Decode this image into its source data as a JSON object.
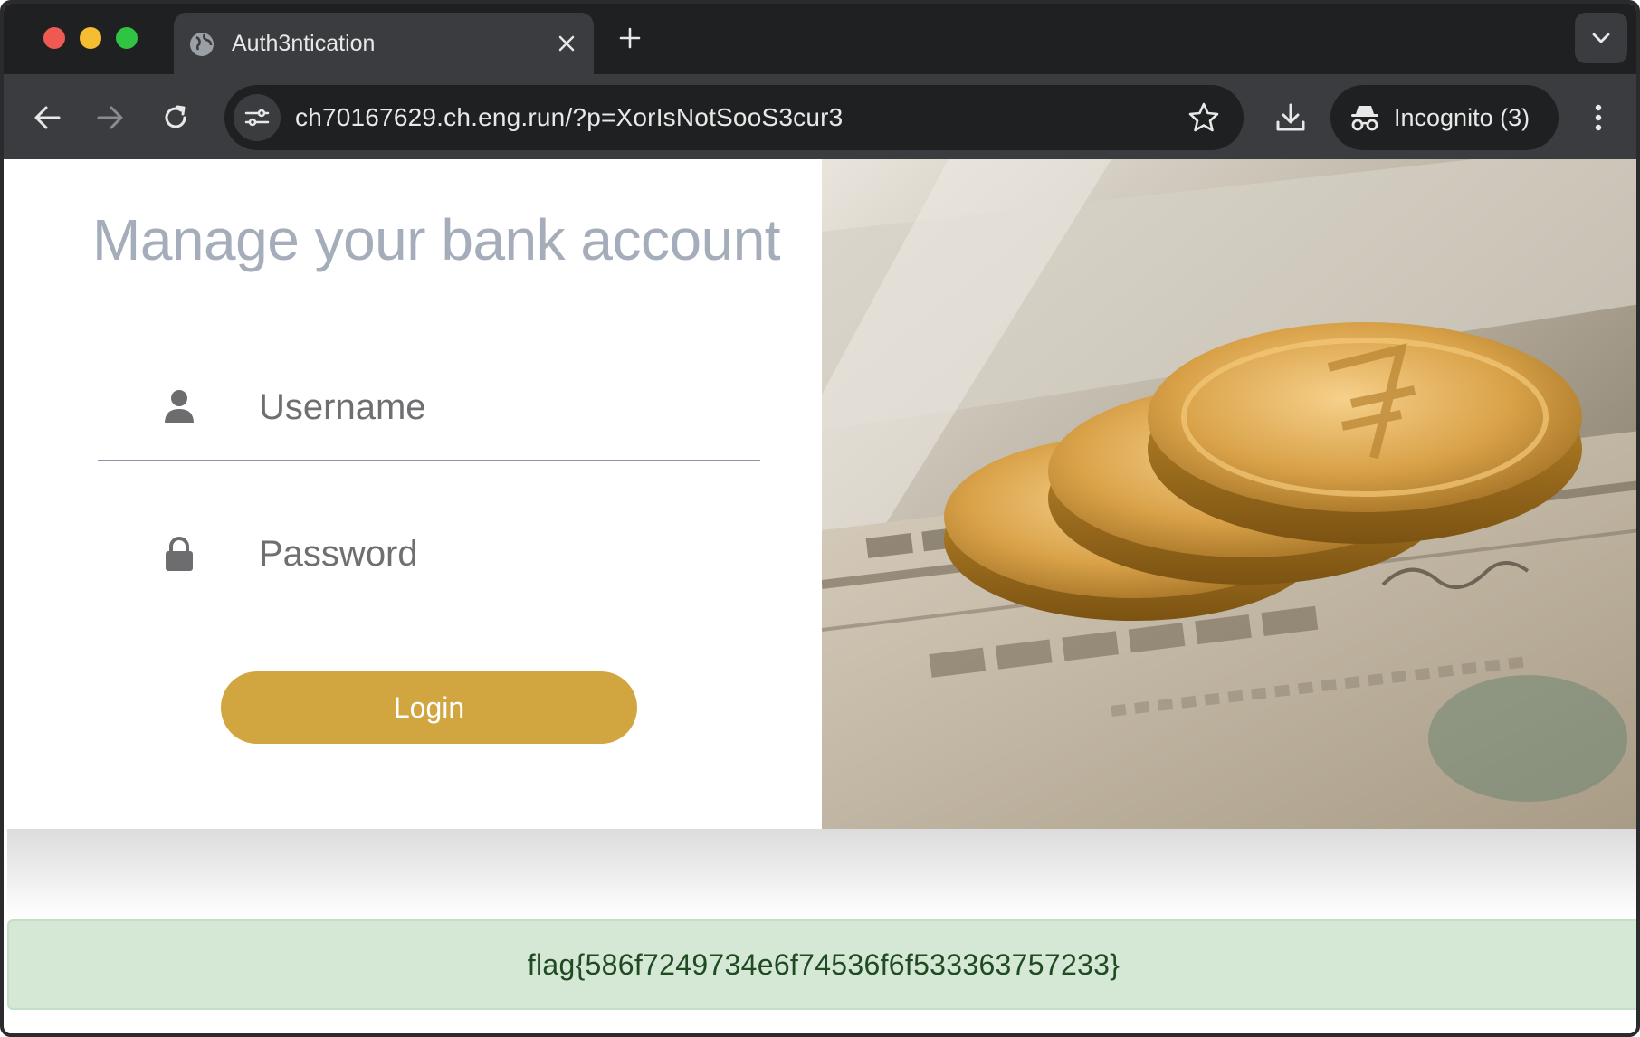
{
  "browser": {
    "tab_title": "Auth3ntication",
    "url": "ch70167629.ch.eng.run/?p=XorIsNotSooS3cur3",
    "incognito_label": "Incognito (3)"
  },
  "page": {
    "heading": "Manage your bank account",
    "username_placeholder": "Username",
    "password_placeholder": "Password",
    "login_label": "Login",
    "flag_text": "flag{586f7249734e6f74536f6f533363757233}"
  },
  "colors": {
    "login_button": "#d1a53f",
    "heading": "#a4adb9",
    "flag_bg": "#d5e8d6",
    "flag_text": "#1f4a22"
  },
  "icons": [
    "globe-icon",
    "close-icon",
    "plus-icon",
    "chevron-down-icon",
    "back-arrow-icon",
    "forward-arrow-icon",
    "reload-icon",
    "site-settings-icon",
    "star-icon",
    "download-icon",
    "incognito-icon",
    "kebab-menu-icon",
    "user-icon",
    "lock-icon"
  ]
}
